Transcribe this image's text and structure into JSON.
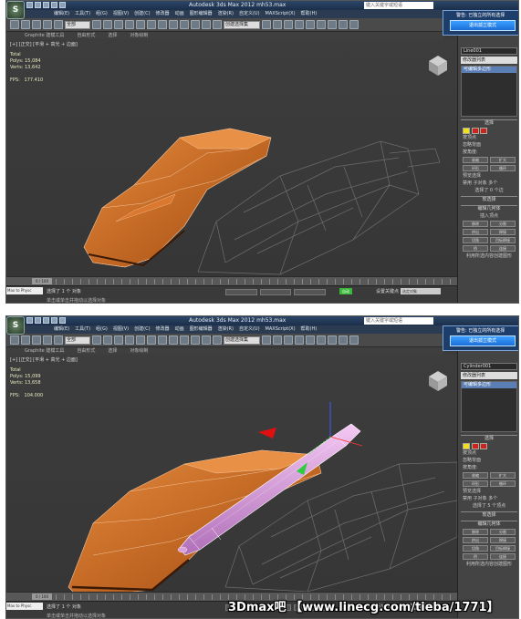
{
  "app": {
    "logo": "S",
    "title_1": "Autodesk 3ds Max 2012    mh53.max",
    "title_2": "Autodesk 3ds Max 2012    mh53.max",
    "search_placeholder": "键入关键字或短语"
  },
  "menu_items": [
    "编辑(E)",
    "工具(T)",
    "组(G)",
    "视图(V)",
    "创建(C)",
    "修改器",
    "动画",
    "图形编辑器",
    "渲染(R)",
    "自定义(U)",
    "MAXScript(X)",
    "帮助(H)"
  ],
  "toolbar": {
    "selection_filter": "全部",
    "selection_set": "创建选择集"
  },
  "ribbon_tabs": [
    "Graphite 建模工具",
    "自由形式",
    "选择",
    "对象绘制"
  ],
  "viewport": {
    "label": "[+] [正交] [平滑 + 高光 + 边面]",
    "stats_1": [
      "Total",
      "Polys: 15,084",
      "Verts: 13,642",
      "",
      "FPS:   177.410"
    ],
    "stats_2": [
      "Total",
      "Polys: 15,099",
      "Verts: 13,658",
      "",
      "FPS:   104.000"
    ]
  },
  "popup": {
    "title": "警告: 已独立的所有选择",
    "button": "退出孤立模式"
  },
  "command_panel": {
    "object_name_1": "Line001",
    "object_name_2": "Cylinder001",
    "modifier_list": "修改器列表",
    "stack_item": "可编辑多边形",
    "selection_header": "选择",
    "by_vertex": "按顶点",
    "ignore_backfacing": "忽略背面",
    "by_angle": "按角度:",
    "shrink": "收缩",
    "grow": "扩大",
    "ring": "环形",
    "loop": "循环",
    "preview_selection": "预览选择",
    "disabled": "禁用",
    "subobject": "子对象",
    "multi": "多个",
    "selected_1": "选择了 0 个边",
    "selected_2": "选择了 5 个顶点",
    "soft_selection": "软选择",
    "edit_geometry": "编辑几何体",
    "insert_vertex": "插入顶点",
    "remove": "移除",
    "split": "分割",
    "extrude": "挤出",
    "weld": "焊接",
    "chamfer": "切角",
    "target_weld": "目标焊接",
    "bridge": "桥",
    "connect": "连接",
    "create_shape": "利用所选内容创建图形"
  },
  "timeline": {
    "frame": "0 / 100"
  },
  "status": {
    "maxscript": "Max to Physc",
    "selected": "选择了 1 个 对象",
    "hint": "单击或单击并拖动以选择对象",
    "auto_key": "自动",
    "set_key": "设置关键点",
    "selection_mode": "选定对象",
    "add_time_tag": "添加时间标记"
  },
  "watermark": "3Dmax吧 【www.linecg.com/tieba/1771】",
  "colors": {
    "orange": "#c25a14",
    "orange_light": "#e07a30",
    "pink": "#e8a8e8",
    "pink_dark": "#b070b8",
    "accent_blue": "#1c6fd8",
    "auto_key_green": "#3bb83b"
  }
}
